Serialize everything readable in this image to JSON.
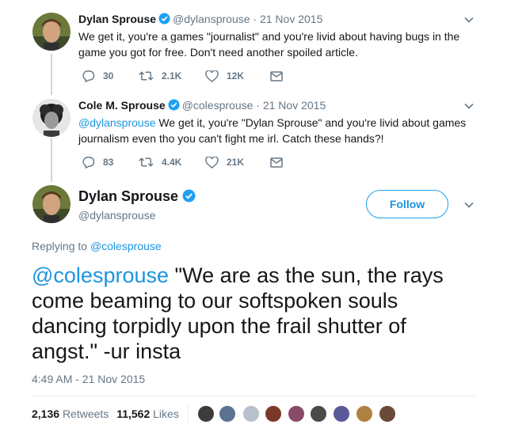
{
  "reply_1": {
    "name": "Dylan Sprouse",
    "handle": "@dylansprouse",
    "date": "· 21 Nov 2015",
    "text": "We get it, you're a games \"journalist\" and you're livid about having bugs in the game you got for free. Don't need another spoiled article.",
    "replies": "30",
    "retweets": "2.1K",
    "likes": "12K"
  },
  "reply_2": {
    "name": "Cole M. Sprouse",
    "handle": "@colesprouse",
    "date": "· 21 Nov 2015",
    "mention": "@dylansprouse",
    "text": " We get it, you're \"Dylan Sprouse\" and you're livid about games journalism even tho you can't fight me irl. Catch these hands?!",
    "replies": "83",
    "retweets": "4.4K",
    "likes": "21K"
  },
  "main": {
    "name": "Dylan Sprouse",
    "handle": "@dylansprouse",
    "follow_label": "Follow",
    "replying_prefix": "Replying to ",
    "replying_to": "@colesprouse",
    "mention": "@colesprouse",
    "text": " \"We are as the sun, the rays come beaming to our softspoken souls dancing torpidly upon the frail shutter of angst.\" -ur insta",
    "timestamp": "4:49 AM - 21 Nov 2015",
    "retweet_count": "2,136",
    "retweet_label": "Retweets",
    "like_count": "11,562",
    "like_label": "Likes"
  },
  "icons": [
    "verified-icon",
    "chevron-down-icon",
    "reply-icon",
    "retweet-icon",
    "like-icon",
    "dm-icon"
  ],
  "colors": {
    "accent": "#1da1f2",
    "link": "#1b95e0",
    "muted": "#657786",
    "text": "#14171a",
    "thread_line": "#ccd6dd"
  }
}
